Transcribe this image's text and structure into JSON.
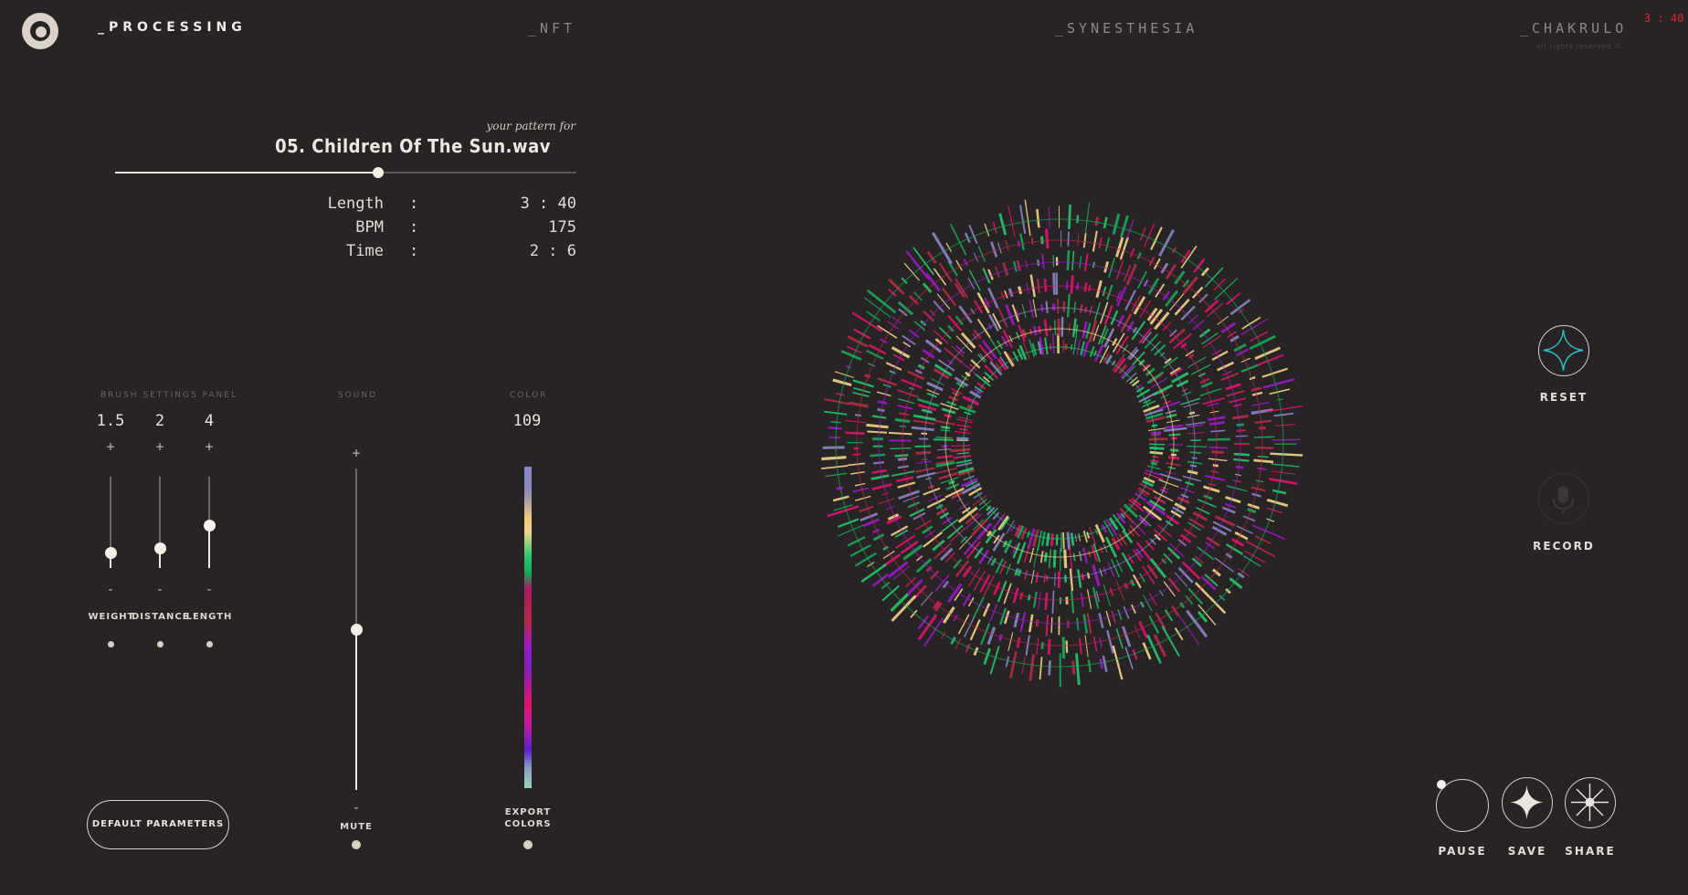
{
  "nav": {
    "processing": "_PROCESSING",
    "nft": "_NFT",
    "synesthesia": "_SYNESTHESIA",
    "chakrulo": "_CHAKRULO",
    "rights": "all rights reserved ©",
    "timer": "3 : 40"
  },
  "track": {
    "pattern_for": "your pattern for",
    "name": "05. Children Of The Sun.wav",
    "progress": 0.57
  },
  "info": {
    "length_label": "Length",
    "length_sep": ":",
    "length_value": "3 : 40",
    "bpm_label": "BPM",
    "bpm_sep": ":",
    "bpm_value": "175",
    "time_label": "Time",
    "time_sep": ":",
    "time_value": "2 : 6"
  },
  "brush": {
    "panel_label": "BRUSH SETTINGS PANEL",
    "weight": {
      "value": "1.5",
      "label": "WEIGHT",
      "level": 0.17,
      "plus": "+",
      "minus": "-"
    },
    "distance": {
      "value": "2",
      "label": "DISTANCE",
      "level": 0.22,
      "plus": "+",
      "minus": "-"
    },
    "length": {
      "value": "4",
      "label": "LENGTH",
      "level": 0.47,
      "plus": "+",
      "minus": "-"
    }
  },
  "sound": {
    "panel_label": "SOUND",
    "plus": "+",
    "minus": "-",
    "mute_label": "MUTE",
    "level": 0.5
  },
  "color": {
    "panel_label": "COLOR",
    "value": "109",
    "export_line1": "EXPORT",
    "export_line2": "COLORS"
  },
  "buttons": {
    "default_parameters": "DEFAULT PARAMETERS",
    "reset": "RESET",
    "record": "RECORD",
    "pause": "PAUSE",
    "save": "SAVE",
    "share": "SHARE"
  },
  "icons": {
    "logo": "logo-ring-icon",
    "reset": "four-point-star-icon",
    "record": "microphone-icon",
    "save": "sparkle-icon",
    "share": "starburst-icon"
  },
  "colors": {
    "background": "#282324",
    "foreground": "#e9e4dd",
    "timer_red": "#e0262a",
    "reset_accent": "#2fc2c2",
    "pattern_palette": [
      "#26c66f",
      "#f4d48a",
      "#8a86c7",
      "#e0146b",
      "#9a1ac7",
      "#b22b47",
      "#17a95c"
    ]
  }
}
